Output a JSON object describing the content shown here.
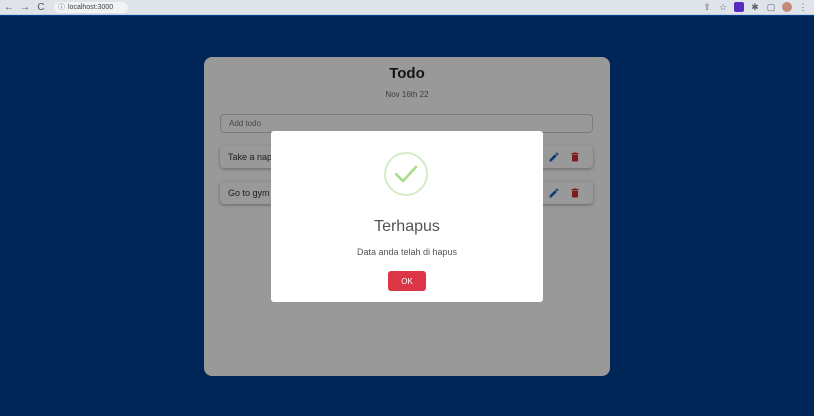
{
  "browser": {
    "url": "localhost:3000"
  },
  "app": {
    "title": "Todo",
    "date": "Nov 16th 22",
    "add_placeholder": "Add todo",
    "todos": [
      {
        "text": "Take a nap"
      },
      {
        "text": "Go to gym"
      }
    ]
  },
  "modal": {
    "title": "Terhapus",
    "message": "Data anda telah di hapus",
    "ok_label": "OK"
  },
  "colors": {
    "page_background": "#003f91",
    "edit_icon": "#1565c0",
    "delete_icon": "#d32f2f",
    "ok_button": "#dc3545",
    "success_check": "#a5dc86"
  },
  "icons": {
    "back": "arrow-left-icon",
    "forward": "arrow-right-icon",
    "reload": "reload-icon",
    "info": "info-icon",
    "share": "share-icon",
    "bookmark": "star-icon",
    "extension": "extension-badge-icon",
    "puzzle": "puzzle-icon",
    "sidepanel": "sidepanel-icon",
    "profile": "avatar",
    "menu": "kebab-menu-icon",
    "edit": "pencil-icon",
    "delete": "trash-icon",
    "success": "check-circle-icon"
  }
}
